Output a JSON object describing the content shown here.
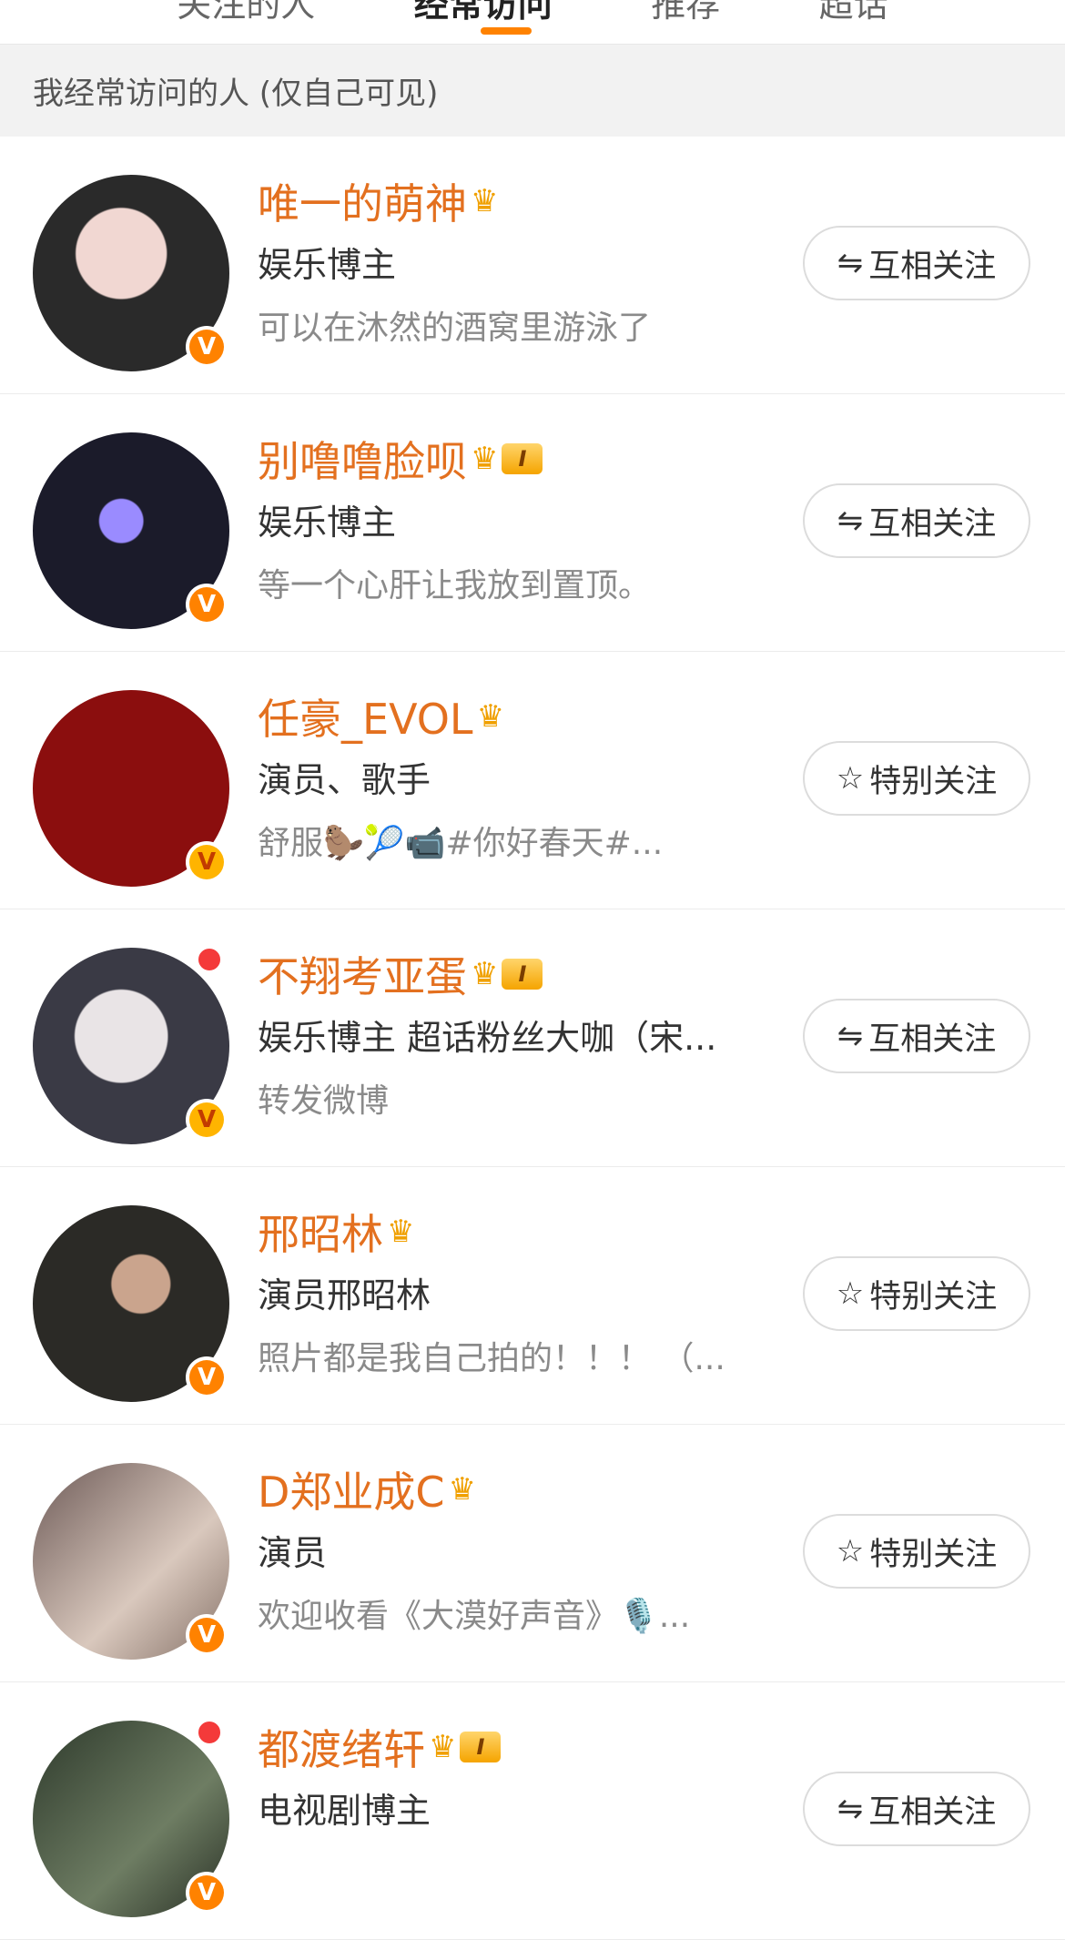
{
  "tabs": [
    {
      "label": "关注的人"
    },
    {
      "label": "经常访问"
    },
    {
      "label": "推荐"
    },
    {
      "label": "超话"
    }
  ],
  "section_header": "我经常访问的人 (仅自己可见)",
  "colors": {
    "accent": "#ff8200",
    "name": "#e3701f"
  },
  "users": [
    {
      "name": "唯一的萌神",
      "crown": true,
      "level": "",
      "desc": "娱乐博主",
      "sub": "可以在沐然的酒窝里游泳了",
      "badge": "orange",
      "dot": false,
      "button": {
        "icon": "⇋",
        "label": "互相关注"
      }
    },
    {
      "name": "别噜噜脸呗",
      "crown": true,
      "level": "I",
      "desc": "娱乐博主",
      "sub": "等一个心肝让我放到置顶。",
      "badge": "orange",
      "dot": false,
      "button": {
        "icon": "⇋",
        "label": "互相关注"
      }
    },
    {
      "name": "任豪_EVOL",
      "crown": true,
      "level": "",
      "desc": "演员、歌手",
      "sub": "舒服🦫🎾📹#你好春天#...",
      "badge": "gold",
      "dot": false,
      "button": {
        "icon": "☆",
        "label": "特别关注"
      }
    },
    {
      "name": "不翔考亚蛋",
      "crown": true,
      "level": "I",
      "desc": "娱乐博主 超话粉丝大咖（宋...",
      "sub": "转发微博",
      "badge": "gold",
      "dot": true,
      "button": {
        "icon": "⇋",
        "label": "互相关注"
      }
    },
    {
      "name": "邢昭林",
      "crown": true,
      "level": "",
      "desc": "演员邢昭林",
      "sub": "照片都是我自己拍的！！！ （...",
      "badge": "orange",
      "dot": false,
      "button": {
        "icon": "☆",
        "label": "特别关注"
      }
    },
    {
      "name": "D郑业成C",
      "crown": true,
      "level": "",
      "desc": "演员",
      "sub": "欢迎收看《大漠好声音》🎙️...",
      "badge": "orange",
      "dot": false,
      "button": {
        "icon": "☆",
        "label": "特别关注"
      }
    },
    {
      "name": "都渡绪轩",
      "crown": true,
      "level": "I",
      "desc": "电视剧博主",
      "sub": "",
      "badge": "orange",
      "dot": true,
      "button": {
        "icon": "⇋",
        "label": "互相关注"
      }
    }
  ]
}
